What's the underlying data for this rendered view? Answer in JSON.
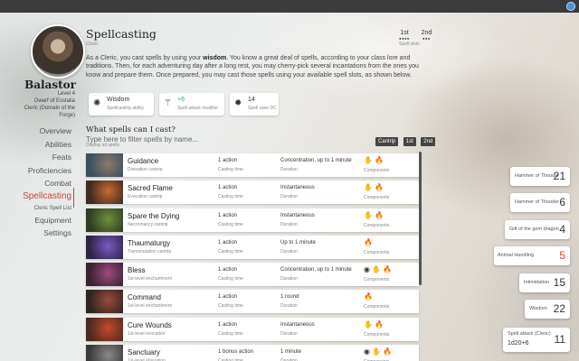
{
  "character": {
    "name": "Balastor",
    "level": "Level 4",
    "race": "Dwarf of Esstalia",
    "class_line1": "Cleric (Domain of the",
    "class_line2": "Forge)"
  },
  "nav": {
    "items": [
      "Overview",
      "Abilities",
      "Feats",
      "Proficiencies",
      "Combat"
    ],
    "active": "Spellcasting",
    "sub": "Cleric Spell List",
    "after": [
      "Equipment",
      "Settings"
    ]
  },
  "header": {
    "title": "Spellcasting",
    "subtitle": "Cleric"
  },
  "slots": {
    "first": {
      "label": "1st",
      "dots": "●●●●"
    },
    "second": {
      "label": "2nd",
      "dots": "●●●"
    },
    "caption": "Spell slots"
  },
  "description": {
    "before": "As a Cleric, you cast spells by using your ",
    "emph": "wisdom",
    "after": ". You know a great deal of spells, according to your class lore and traditions. Then, for each adventuring day after a long rest, you may cherry-pick several incantations from the ones you know and prepare them. Once prepared, you may cast those spells using your available spell slots, as shown below."
  },
  "stats": [
    {
      "icon": "brain-icon",
      "glyph": "✺",
      "value": "Wisdom",
      "label": "Spellcasting ability"
    },
    {
      "icon": "wand-icon",
      "glyph": "⚚",
      "value": "+6",
      "label": "Spell attack modifier"
    },
    {
      "icon": "burst-icon",
      "glyph": "✹",
      "value": "14",
      "label": "Spell save DC"
    }
  ],
  "spells_section": {
    "title": "What spells can I cast?",
    "placeholder": "Type here to filter spells by name...",
    "filter_sub": "Display all spells",
    "tabs": [
      "Cantrip",
      "1st",
      "2nd"
    ]
  },
  "spells": [
    {
      "name": "Guidance",
      "school": "Divination cantrip",
      "time": "1 action",
      "duration": "Concentration, up to 1 minute",
      "components": "✋🔥",
      "colors": [
        "#8d7a6a",
        "#3b4f5f"
      ]
    },
    {
      "name": "Sacred Flame",
      "school": "Evocation cantrip",
      "time": "1 action",
      "duration": "Instantaneous",
      "components": "✋🔥",
      "colors": [
        "#c86a2d",
        "#3d2a22"
      ]
    },
    {
      "name": "Spare the Dying",
      "school": "Necromancy cantrip",
      "time": "1 action",
      "duration": "Instantaneous",
      "components": "✋🔥",
      "colors": [
        "#6d8f3a",
        "#2f3c24"
      ]
    },
    {
      "name": "Thaumaturgy",
      "school": "Transmutation cantrip",
      "time": "1 action",
      "duration": "Up to 1 minute",
      "components": "🔥",
      "colors": [
        "#7a5bc2",
        "#2e2445"
      ]
    },
    {
      "name": "Bless",
      "school": "1st-level enchantment",
      "time": "1 action",
      "duration": "Concentration, up to 1 minute",
      "components": "◉✋🔥",
      "colors": [
        "#a04a7d",
        "#3a2233"
      ]
    },
    {
      "name": "Command",
      "school": "1st-level enchantment",
      "time": "1 action",
      "duration": "1 round",
      "components": "🔥",
      "colors": [
        "#9a4b3a",
        "#2e2520"
      ]
    },
    {
      "name": "Cure Wounds",
      "school": "1st-level evocation",
      "time": "1 action",
      "duration": "Instantaneous",
      "components": "✋🔥",
      "colors": [
        "#c84a2d",
        "#4a2a1e"
      ]
    },
    {
      "name": "Sanctuary",
      "school": "1st-level abjuration",
      "time": "1 bonus action",
      "duration": "1 minute",
      "components": "◉✋🔥",
      "colors": [
        "#8a8a8a",
        "#3a3a3a"
      ]
    }
  ],
  "rolls": [
    {
      "label": "Hammer of Thooder",
      "value": "21",
      "red": false
    },
    {
      "label": "Hammer of Thooder",
      "value": "6",
      "red": false
    },
    {
      "label": "Gift of the gem dragon",
      "value": "4",
      "red": false
    },
    {
      "label": "Animal Handling",
      "value": "5",
      "red": true
    },
    {
      "label": "Intimidation",
      "value": "15",
      "red": false
    },
    {
      "label": "Wisdom",
      "value": "22",
      "red": false
    }
  ],
  "spell_attack": {
    "label": "Spell attack (Cleric)",
    "formula": "1d20+6",
    "value": "11"
  }
}
